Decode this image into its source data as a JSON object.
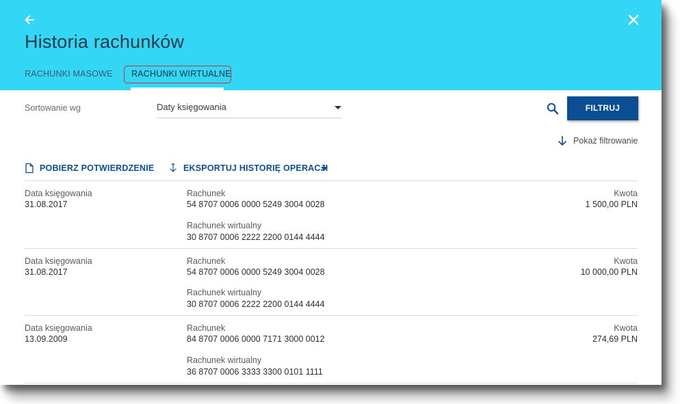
{
  "header": {
    "title": "Historia rachunków",
    "tabs": [
      {
        "label": "RACHUNKI MASOWE",
        "active": false
      },
      {
        "label": "RACHUNKI WIRTUALNE",
        "active": true
      }
    ],
    "icons": {
      "back": "arrow-left-icon",
      "close": "close-icon"
    }
  },
  "sort": {
    "label": "Sortowanie wg",
    "value": "Daty księgowania"
  },
  "filter_button": "FILTRUJ",
  "show_filter": "Pokaż filtrowanie",
  "actions": {
    "confirm": "POBIERZ POTWIERDZENIE",
    "export": "EKSPORTUJ HISTORIĘ OPERACJI"
  },
  "rows": [
    {
      "date_label": "Data księgowania",
      "date": "31.08.2017",
      "account_label": "Rachunek",
      "account": "54 8707 0006 0000 5249 3004 0028",
      "virtual_label": "Rachunek wirtualny",
      "virtual": "30 8707 0006 2222 2200 0144 4444",
      "amount_label": "Kwota",
      "amount": "1 500,00  PLN"
    },
    {
      "date_label": "Data księgowania",
      "date": "31.08.2017",
      "account_label": "Rachunek",
      "account": "54 8707 0006 0000 5249 3004 0028",
      "virtual_label": "Rachunek wirtualny",
      "virtual": "30 8707 0006 2222 2200 0144 4444",
      "amount_label": "Kwota",
      "amount": "10 000,00  PLN"
    },
    {
      "date_label": "Data księgowania",
      "date": "13.09.2009",
      "account_label": "Rachunek",
      "account": "84 8707 0006 0000 7171 3000 0012",
      "virtual_label": "Rachunek wirtualny",
      "virtual": "36 8707 0006 3333 3300 0101 1111",
      "amount_label": "Kwota",
      "amount": "274,69  PLN"
    }
  ],
  "colors": {
    "header_bg": "#33d6f5",
    "primary": "#0c4e93",
    "tab_highlight": "#d0303a"
  }
}
